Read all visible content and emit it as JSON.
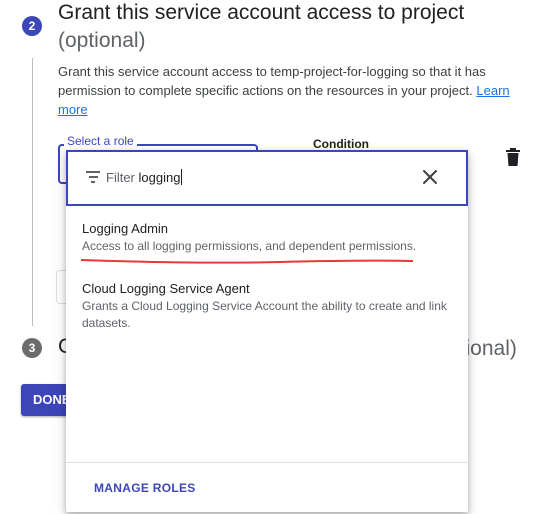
{
  "step2": {
    "number": "2",
    "title": "Grant this service account access to project",
    "optional": "(optional)",
    "description_text": "Grant this service account access to temp-project-for-logging so that it has permission to complete specific actions on the resources in your project. ",
    "learn_more": "Learn more",
    "role_field_label": "Select a role",
    "condition_label": "Condition",
    "delete_icon": "trash-icon"
  },
  "step3": {
    "number": "3",
    "title_partial": "G",
    "optional_partial": "ptional)"
  },
  "done_button": "DONE",
  "dropdown": {
    "filter_label": "Filter",
    "filter_value": "logging",
    "filter_icon": "filter-icon",
    "clear_icon": "close-icon",
    "options": [
      {
        "title": "Logging Admin",
        "description": "Access to all logging permissions, and dependent permissions.",
        "highlighted": true,
        "highlight_color": "#e53935"
      },
      {
        "title": "Cloud Logging Service Agent",
        "description": "Grants a Cloud Logging Service Account the ability to create and link datasets."
      }
    ],
    "manage_roles": "MANAGE ROLES"
  },
  "colors": {
    "accent": "#3c46b8",
    "link": "#1a73e8",
    "annotation": "#e53935"
  }
}
